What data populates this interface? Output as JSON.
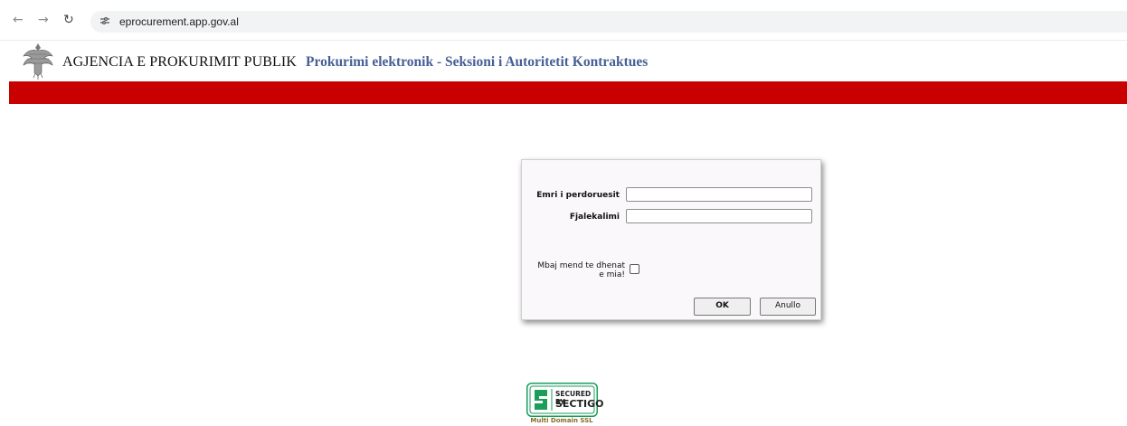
{
  "browser": {
    "back_icon": "back-arrow-icon",
    "forward_icon": "forward-arrow-icon",
    "reload_icon": "reload-icon",
    "site_info_icon": "site-info-icon",
    "url": "eprocurement.app.gov.al"
  },
  "header": {
    "logo_icon": "albanian-eagle-emblem",
    "agency_name": "AGJENCIA E PROKURIMIT PUBLIK",
    "system_title": "Prokurimi elektronik - Seksioni i Autoritetit Kontraktues",
    "title_color": "#465f96",
    "band_color": "#c80000"
  },
  "login": {
    "username_label": "Emri i perdoruesit",
    "username_value": "",
    "password_label": "Fjalekalimi",
    "password_value": "",
    "remember_label": "Mbaj mend te dhenat e mia!",
    "remember_checked": false,
    "ok_label": "OK",
    "cancel_label": "Anullo"
  },
  "footer": {
    "seal_line1": "SECURED BY",
    "seal_line2": "SECTIGO",
    "seal_caption": "Multi Domain SSL",
    "seal_color": "#1a9e5a"
  }
}
